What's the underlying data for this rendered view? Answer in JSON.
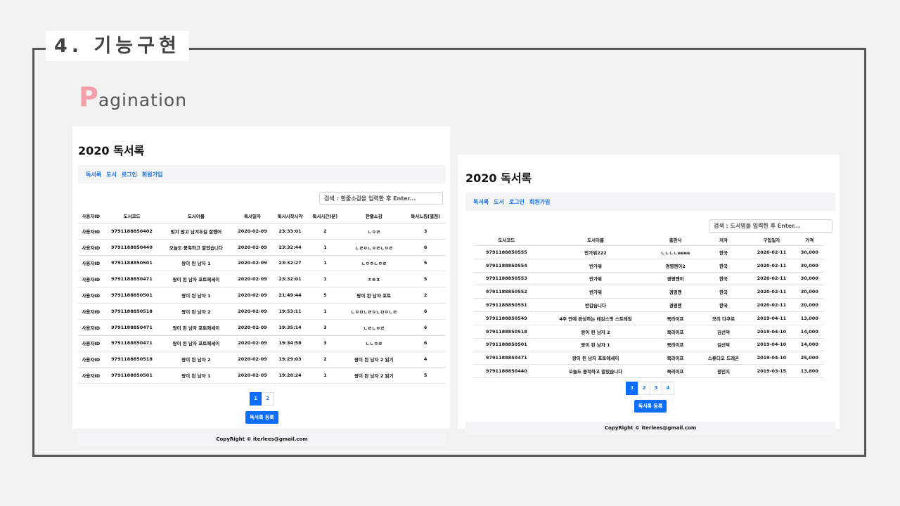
{
  "slide": {
    "section_title": "4. 기능구현",
    "heading_cap": "P",
    "heading_rest": "agination"
  },
  "left": {
    "title": "2020 독서록",
    "nav": [
      "독서록",
      "도서",
      "로그인",
      "회원가입"
    ],
    "search_placeholder": "검색 : 한줄소감을 입력한 후 Enter...",
    "columns": [
      "사용자ID",
      "도서코드",
      "도서이름",
      "독서일자",
      "독서시작시각",
      "독서시간(분)",
      "한줄소감",
      "독서느낌(별점)"
    ],
    "rows": [
      [
        "사용자ID",
        "9791188850402",
        "잊지 않고 남겨두길 잘했어",
        "2020-02-09",
        "23:33:01",
        "2",
        "ㄴㅇㄹ",
        "3"
      ],
      [
        "사용자ID",
        "9791188850440",
        "오늘도 뭉쳐하고 말았습니다",
        "2020-02-09",
        "23:32:44",
        "1",
        "ㄴㄹㅇㄴㅇㄹㄴㅇㄹ",
        "6"
      ],
      [
        "사용자ID",
        "9791188850501",
        "왕이 된 남자 1",
        "2020-02-09",
        "23:32:27",
        "1",
        "ㄴㅇㅇㄴㅇㄹ",
        "5"
      ],
      [
        "사용자ID",
        "9791188850471",
        "왕이 된 남자 포토에세이",
        "2020-02-09",
        "23:32:01",
        "1",
        "ㅊㅌㅍ",
        "5"
      ],
      [
        "사용자ID",
        "9791188850501",
        "왕이 된 남자 1",
        "2020-02-09",
        "21:49:44",
        "5",
        "왕이 된 남자 포토",
        "2"
      ],
      [
        "사용자ID",
        "9791188850518",
        "왕이 된 남자 2",
        "2020-02-09",
        "19:53:11",
        "1",
        "ㄴㅇㅁㄴㄹㅇㄴㅁㅇㄴㄹ",
        "6"
      ],
      [
        "사용자ID",
        "9791188850471",
        "왕이 된 남자 포토에세이",
        "2020-02-09",
        "19:35:14",
        "3",
        "ㄴㄹㄴㅇㄹ",
        "6"
      ],
      [
        "사용자ID",
        "9791188850471",
        "왕이 된 남자 포토에세이",
        "2020-02-09",
        "19:34:58",
        "3",
        "ㄴㄴㅇㄹ",
        "6"
      ],
      [
        "사용자ID",
        "9791188850518",
        "왕이 된 남자 2",
        "2020-02-09",
        "19:29:03",
        "2",
        "왕이 된 남자 2 읽기",
        "4"
      ],
      [
        "사용자ID",
        "9791188850501",
        "왕이 된 남자 1",
        "2020-02-09",
        "19:28:24",
        "1",
        "왕이 된 남자 2 읽기",
        "5"
      ]
    ],
    "pages": [
      "1",
      "2"
    ],
    "active_page": "1",
    "register_button": "독서록 등록",
    "footer": "CopyRight © iterlees@gmail.com"
  },
  "right": {
    "title": "2020 독서록",
    "nav": [
      "독서록",
      "도서",
      "로그인",
      "회원가입"
    ],
    "search_placeholder": "검색 : 도서명을 입력한 후 Enter...",
    "columns": [
      "도서코드",
      "도서이름",
      "출판사",
      "저자",
      "구입일자",
      "가격"
    ],
    "rows": [
      [
        "9791188850555",
        "반가워222",
        "ㄴㄴㄴㄴeeee",
        "한국",
        "2020-02-11",
        "30,000"
      ],
      [
        "9791188850554",
        "반가워",
        "경영맨이2",
        "한국",
        "2020-02-11",
        "30,000"
      ],
      [
        "9791188850553",
        "반가워",
        "경영맨이",
        "한국",
        "2020-02-11",
        "30,000"
      ],
      [
        "9791188850552",
        "반가워",
        "경영맨",
        "한국",
        "2020-02-11",
        "30,000"
      ],
      [
        "9791188850551",
        "반갑습니다",
        "경영맨",
        "한국",
        "2020-02-11",
        "20,000"
      ],
      [
        "9791188850549",
        "4주 안에 완성하는 레깅스핏 스트레칭",
        "북라이프",
        "모리 다쿠로",
        "2019-04-11",
        "13,000"
      ],
      [
        "9791188850518",
        "왕이 된 남자 2",
        "북라이프",
        "김선덕",
        "2019-04-10",
        "14,000"
      ],
      [
        "9791188850501",
        "왕이 된 남자 1",
        "북라이프",
        "김선덕",
        "2019-04-10",
        "14,000"
      ],
      [
        "9791188850471",
        "왕이 된 남자 포토에세이",
        "북라이프",
        "스튜디오 드래곤",
        "2019-04-10",
        "25,000"
      ],
      [
        "9791188850440",
        "오늘도 뭉쳐하고 말았습니다",
        "북라이프",
        "정민지",
        "2019-03-15",
        "13,800"
      ]
    ],
    "pages": [
      "1",
      "2",
      "3",
      "4"
    ],
    "active_page": "1",
    "register_button": "독서록 등록",
    "footer": "CopyRight © iterlees@gmail.com"
  }
}
